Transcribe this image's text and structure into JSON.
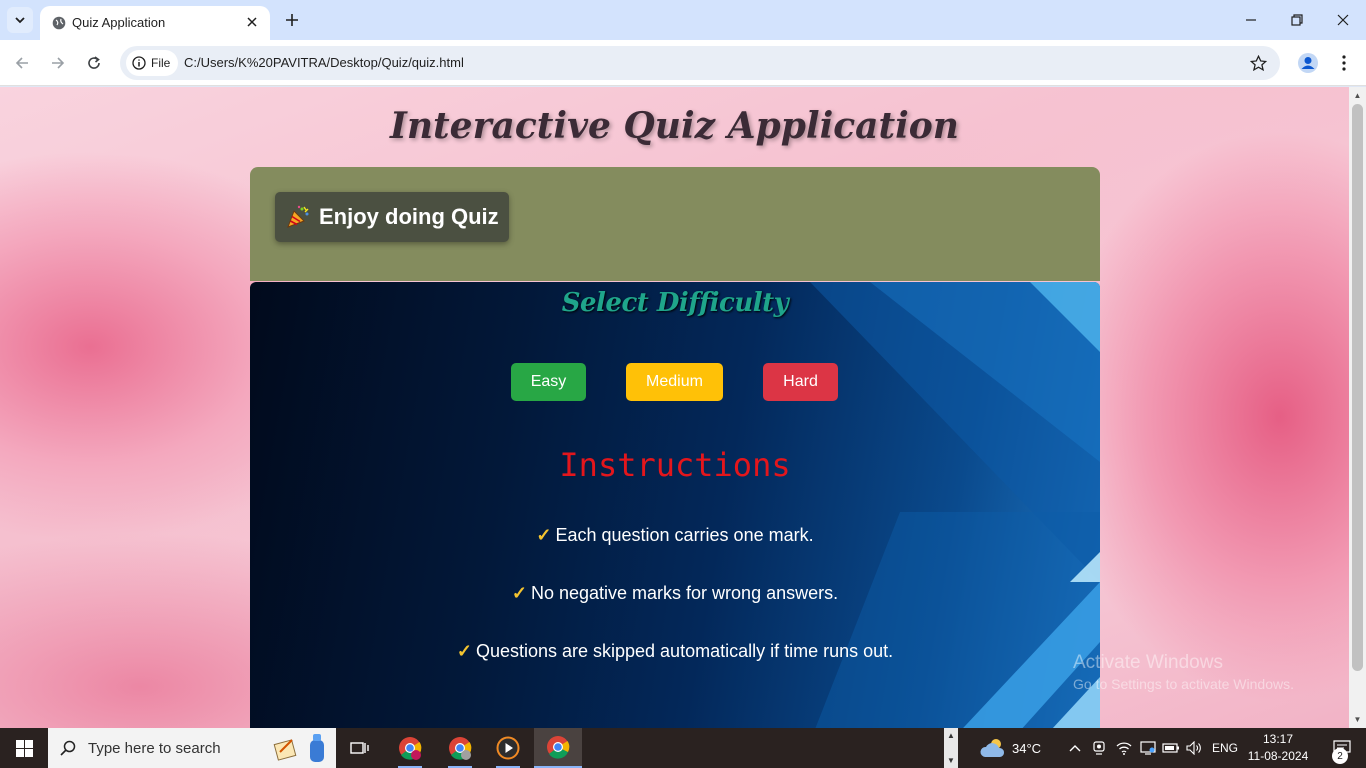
{
  "browser": {
    "tab_title": "Quiz Application",
    "site_chip": "File",
    "url": "C:/Users/K%20PAVITRA/Desktop/Quiz/quiz.html"
  },
  "page": {
    "title": "Interactive Quiz Application",
    "banner_label": "Enjoy doing Quiz",
    "difficulty_title": "Select Difficulty",
    "buttons": {
      "easy": "Easy",
      "medium": "Medium",
      "hard": "Hard"
    },
    "button_colors": {
      "easy": "#28a745",
      "medium": "#ffc107",
      "hard": "#dc3545"
    },
    "instructions_title": "Instructions",
    "check_mark": "✓",
    "instructions": [
      "Each question carries one mark.",
      "No negative marks for wrong answers.",
      "Questions are skipped automatically if time runs out."
    ]
  },
  "watermark": {
    "line1": "Activate Windows",
    "line2": "Go to Settings to activate Windows."
  },
  "taskbar": {
    "search_placeholder": "Type here to search",
    "temperature": "34°C",
    "language": "ENG",
    "time": "13:17",
    "date": "11-08-2024",
    "notification_count": "2"
  },
  "icons": [
    "tab-list-icon",
    "globe-icon",
    "close-icon",
    "plus-icon",
    "minimize-icon",
    "restore-icon",
    "back-icon",
    "forward-icon",
    "reload-icon",
    "info-icon",
    "star-icon",
    "profile-icon",
    "menu-icon",
    "party-popper-icon",
    "windows-icon",
    "search-icon",
    "task-view-icon",
    "chrome-icon",
    "media-player-icon",
    "weather-icon"
  ]
}
